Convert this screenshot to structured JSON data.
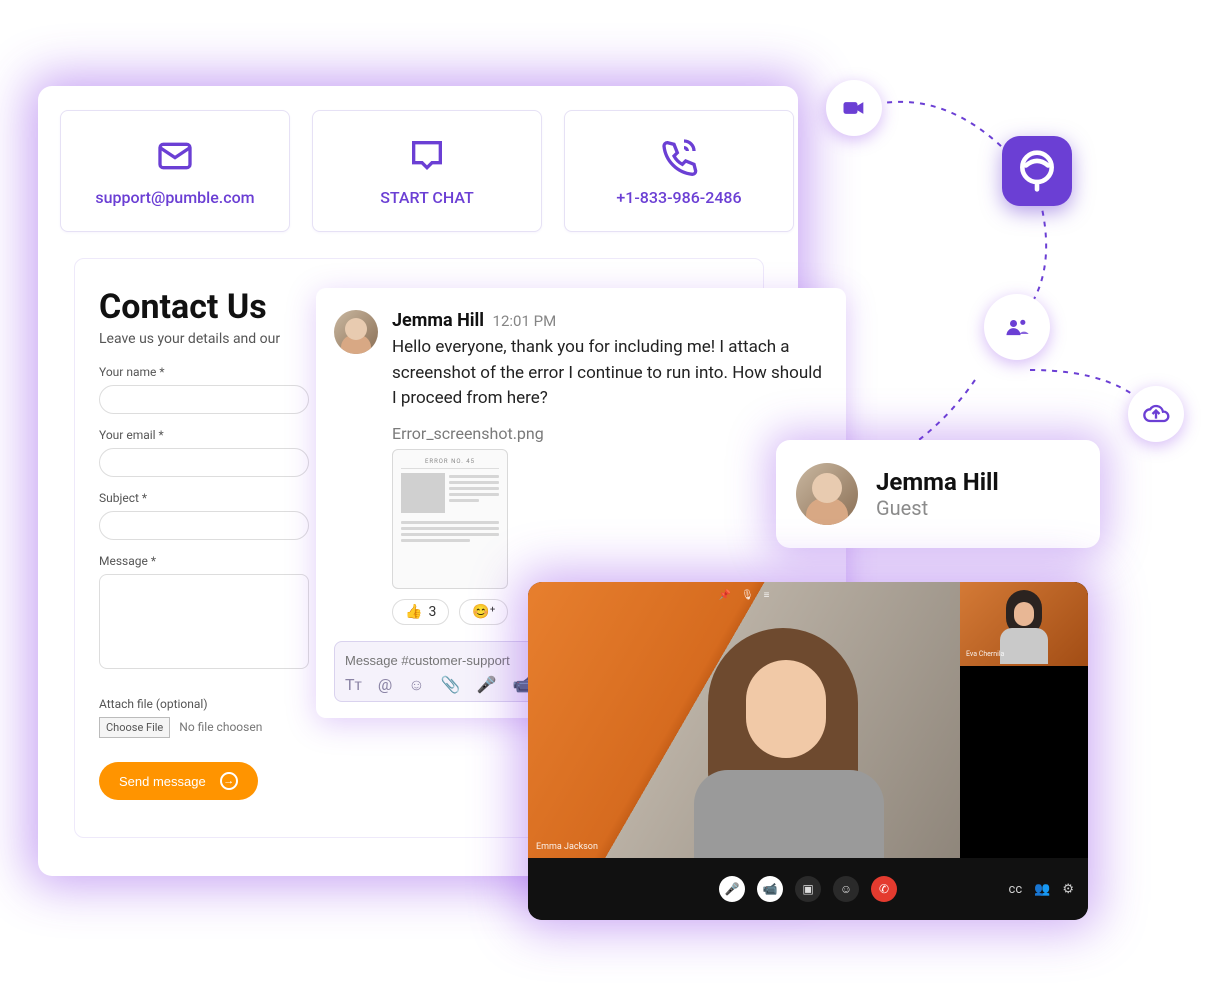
{
  "tiles": {
    "email": "support@pumble.com",
    "chat": "START CHAT",
    "phone": "+1-833-986-2486"
  },
  "form": {
    "heading": "Contact Us",
    "sub": "Leave us your details and our",
    "labels": {
      "name": "Your name *",
      "email": "Your email *",
      "subject": "Subject *",
      "message": "Message *",
      "attach": "Attach file (optional)"
    },
    "choose_file": "Choose File",
    "no_file": "No file choosen",
    "send": "Send message"
  },
  "chat": {
    "author": "Jemma Hill",
    "time": "12:01 PM",
    "body": "Hello everyone, thank you for including me! I attach a screenshot of the error I continue to run into. How should I proceed from here?",
    "attachment_name": "Error_screenshot.png",
    "attachment_header": "ERROR NO. 45",
    "reaction_emoji": "👍",
    "reaction_count": "3",
    "compose_placeholder": "Message #customer-support"
  },
  "guest": {
    "name": "Jemma Hill",
    "role": "Guest"
  },
  "video": {
    "main_name": "Emma Jackson",
    "side_name": "Eva Chernila"
  }
}
